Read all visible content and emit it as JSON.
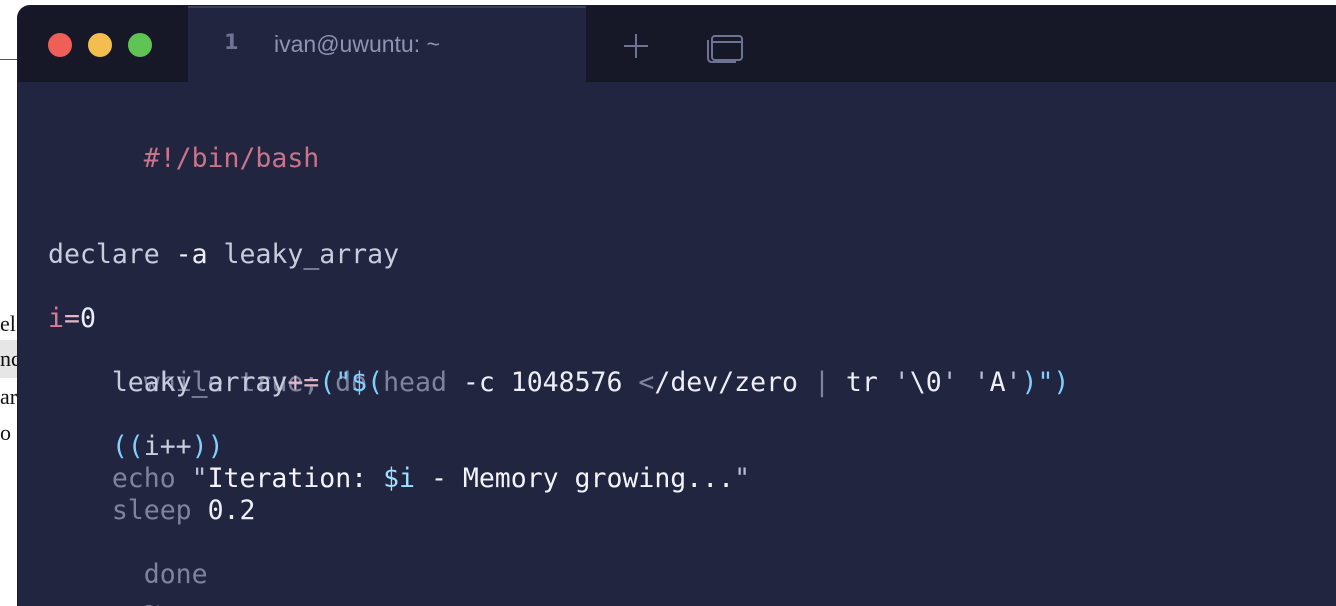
{
  "background_doc": {
    "lines": [
      "el",
      "nd",
      "ar",
      "o"
    ]
  },
  "window": {
    "tabs": [
      {
        "number": "1",
        "title": "ivan@uwuntu: ~"
      }
    ],
    "buttons": {
      "new_tab_icon": "plus-icon",
      "tab_overview_icon": "windows-icon"
    },
    "colors": {
      "close": "#ee5f57",
      "minimize": "#f3bd4f",
      "maximize": "#5fc454",
      "background": "#22253f",
      "titlebar": "#161827"
    }
  },
  "terminal": {
    "shebang": "#!/bin/bash",
    "declare": {
      "cmd": "declare",
      "flag": "-a",
      "name": "leaky_array"
    },
    "assign": {
      "var": "i",
      "eq": "=",
      "val": "0"
    },
    "while_line": "while true; do",
    "append": {
      "indent": "    ",
      "name": "leaky_array",
      "op": "+=",
      "open": "(\"$(",
      "head": "head",
      "flag": "-c",
      "num": "1048576",
      "redir": "<",
      "path": "/dev/zero",
      "pipe": "|",
      "tr": "tr",
      "arg1_q1": "'",
      "arg1": "\\0",
      "arg1_q2": "'",
      "arg2_q1": "'",
      "arg2": "A",
      "arg2_q2": "'",
      "close": ")\")"
    },
    "incr": {
      "indent": "    ",
      "open": "((",
      "expr": "i++",
      "close": "))"
    },
    "echo": {
      "indent": "    ",
      "cmd": "echo",
      "q1": "\"",
      "text1": "Iteration: ",
      "var": "$i",
      "text2": " - Memory growing...",
      "q2": "\""
    },
    "sleep": {
      "indent": "    ",
      "cmd": "sleep",
      "val": "0.2"
    },
    "done": "done",
    "tilde": "~"
  }
}
